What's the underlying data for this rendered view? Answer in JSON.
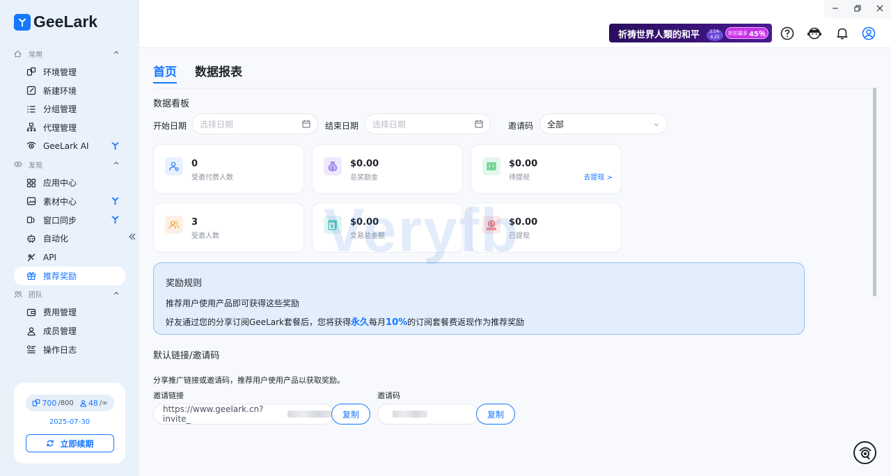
{
  "app": {
    "name": "GeeLark"
  },
  "sidebar": {
    "sections": [
      {
        "label": "常用",
        "items": [
          {
            "label": "环境管理"
          },
          {
            "label": "新建环境"
          },
          {
            "label": "分组管理"
          },
          {
            "label": "代理管理"
          },
          {
            "label": "GeeLark AI"
          }
        ]
      },
      {
        "label": "发现",
        "items": [
          {
            "label": "应用中心"
          },
          {
            "label": "素材中心"
          },
          {
            "label": "窗口同步"
          },
          {
            "label": "自动化"
          },
          {
            "label": "API"
          },
          {
            "label": "推荐奖励"
          }
        ]
      },
      {
        "label": "团队",
        "items": [
          {
            "label": "费用管理"
          },
          {
            "label": "成员管理"
          },
          {
            "label": "操作日志"
          }
        ]
      }
    ],
    "account": {
      "env_used": "700",
      "env_total": "/800",
      "members_used": "48",
      "members_total": "/∞",
      "expire_date": "2025-07-30",
      "renew_label": "立即续期"
    }
  },
  "topbar": {
    "banner_text": "祈祷世界人類的和平",
    "banner_date": "2.14-4.25",
    "banner_badge_prefix": "折扣最多",
    "banner_badge_value": "45％"
  },
  "tabs": [
    {
      "label": "首页",
      "active": true
    },
    {
      "label": "数据报表",
      "active": false
    }
  ],
  "dashboard": {
    "title": "数据看板",
    "start_label": "开始日期",
    "start_placeholder": "选择日期",
    "end_label": "结束日期",
    "end_placeholder": "选择日期",
    "invite_label": "邀请码",
    "invite_value": "全部",
    "stats": [
      {
        "value": "0",
        "label": "受邀付费人数",
        "icon": "user-plus-icon",
        "color": "#3b82f6"
      },
      {
        "value": "$0.00",
        "label": "总奖励金",
        "icon": "money-bag-icon",
        "color": "#7c5cf0"
      },
      {
        "value": "$0.00",
        "label": "待提现",
        "icon": "cash-icon",
        "color": "#22c55e",
        "link": "去提现 >"
      },
      {
        "value": "3",
        "label": "受邀人数",
        "icon": "users-icon",
        "color": "#f5a34a"
      },
      {
        "value": "$0.00",
        "label": "交易总金额",
        "icon": "cash-stack-icon",
        "color": "#14b8a6"
      },
      {
        "value": "$0.00",
        "label": "已提现",
        "icon": "withdrawn-icon",
        "color": "#ef4444"
      }
    ]
  },
  "rules": {
    "title": "奖励规则",
    "line1": "推荐用户使用产品即可获得这些奖励",
    "line2_a": "好友通过您的分享订阅GeeLark套餐后，您将获得",
    "line2_b": "永久",
    "line2_c": "每月",
    "line2_d": "10%",
    "line2_e": "的订阅套餐费返现作为推荐奖励"
  },
  "links": {
    "title": "默认链接/邀请码",
    "desc": "分享推广链接或邀请码，推荐用户使用产品以获取奖励。",
    "link_label": "邀请链接",
    "link_value": "https://www.geelark.cn?invite_",
    "code_label": "邀请码",
    "copy_label": "复制"
  },
  "watermark": "Veryfb"
}
